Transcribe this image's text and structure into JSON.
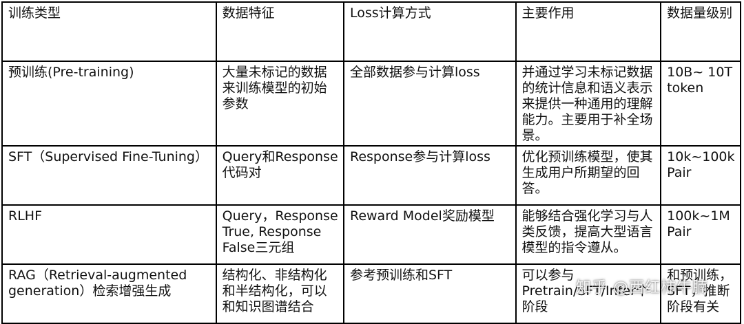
{
  "table": {
    "headers": [
      "训练类型",
      "数据特征",
      "Loss计算方式",
      "主要作用",
      "数据量级别"
    ],
    "rows": [
      [
        "预训练(Pre-training)",
        "大量未标记的数据来训练模型的初始参数",
        "全部数据参与计算loss",
        "并通过学习未标记数据的统计信息和语义表示来提供一种通用的理解能力。主要用于补全场景。",
        "10B~ 10T token"
      ],
      [
        "SFT（Supervised Fine-Tuning）",
        "Query和Response代码对",
        "Response参与计算loss",
        "优化预训练模型，使其生成用户所期望的回答。",
        "10k~100k Pair"
      ],
      [
        "RLHF",
        "Query，Response True, Response False三元组",
        "Reward Model奖励模型",
        "能够结合强化学习与人类反馈，提高大型语言模型的指令遵从。",
        "100k~1M Pair"
      ],
      [
        "RAG（Retrieval-augmented generation）检索增强生成",
        "结构化、非结构化和半结构化，可以和知识图谱结合",
        "参考预训练和SFT",
        "可以参与Pretrain/SFT/Infer个阶段",
        "和预训练，SFT，推断阶段有关"
      ]
    ]
  },
  "watermark": "知乎 @西红柿牛腩"
}
